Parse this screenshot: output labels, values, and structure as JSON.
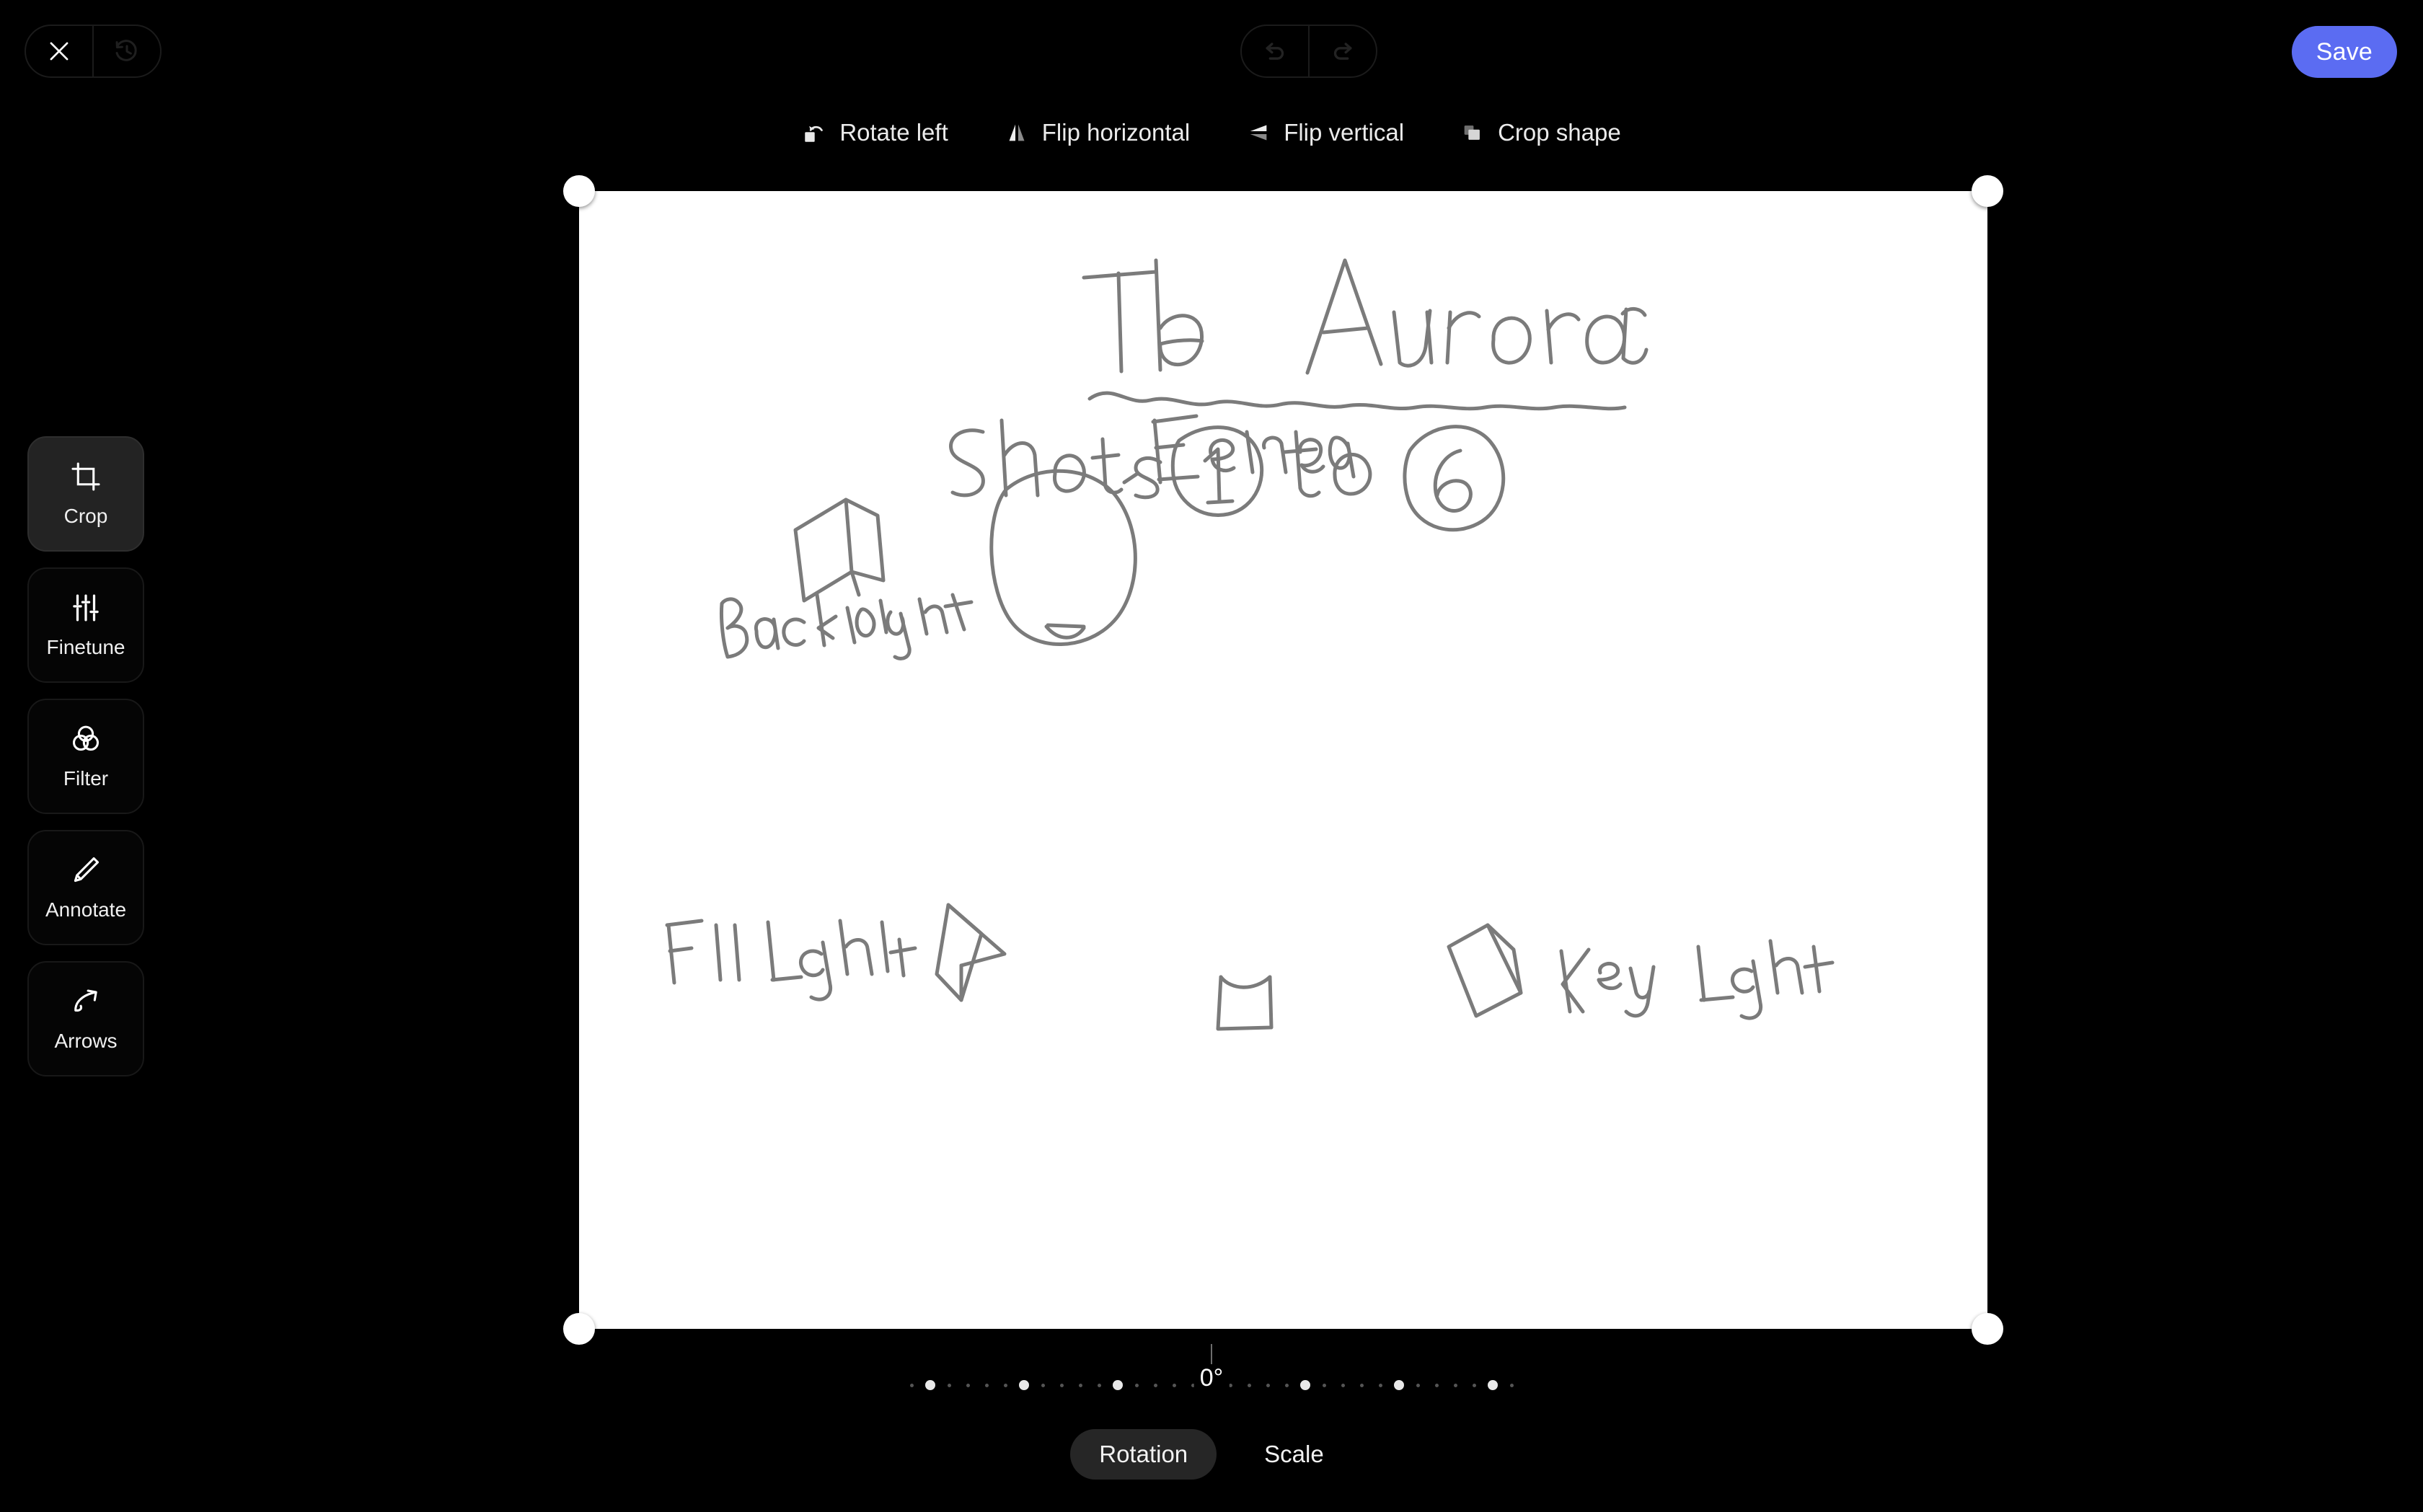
{
  "app": {
    "background_color": "#000000",
    "accent_color": "#5b6cf2"
  },
  "topbar": {
    "close_icon": "close-icon",
    "revert_icon": "history-revert-icon",
    "undo_icon": "undo-icon",
    "redo_icon": "redo-icon",
    "save_label": "Save"
  },
  "util_toolbar": {
    "items": [
      {
        "label": "Rotate left",
        "icon": "rotate-left-icon"
      },
      {
        "label": "Flip horizontal",
        "icon": "flip-horizontal-icon"
      },
      {
        "label": "Flip vertical",
        "icon": "flip-vertical-icon"
      },
      {
        "label": "Crop shape",
        "icon": "crop-shape-icon"
      }
    ]
  },
  "tool_rail": {
    "items": [
      {
        "label": "Crop",
        "icon": "crop-icon",
        "active": true
      },
      {
        "label": "Finetune",
        "icon": "sliders-icon",
        "active": false
      },
      {
        "label": "Filter",
        "icon": "filter-circles-icon",
        "active": false
      },
      {
        "label": "Annotate",
        "icon": "pencil-icon",
        "active": false
      },
      {
        "label": "Arrows",
        "icon": "curved-arrow-icon",
        "active": false
      }
    ]
  },
  "editor": {
    "rotation_value": "0°",
    "tabs": [
      {
        "label": "Rotation",
        "active": true
      },
      {
        "label": "Scale",
        "active": false
      }
    ]
  },
  "image": {
    "description": "pencil storyboard sketch on white paper",
    "handwriting": {
      "title": "The Aurora",
      "subtitle": "Shots 1 to 6",
      "shot_from": "1",
      "shot_to": "6",
      "labels": [
        "Backlight",
        "Elena",
        "Fill Light",
        "Key Light"
      ]
    }
  }
}
